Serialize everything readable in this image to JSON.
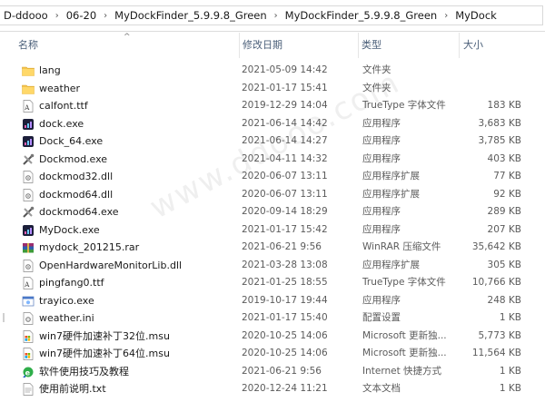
{
  "breadcrumb": [
    "D-ddooo",
    "06-20",
    "MyDockFinder_5.9.9.8_Green",
    "MyDockFinder_5.9.9.8_Green",
    "MyDock"
  ],
  "columns": {
    "name": "名称",
    "date": "修改日期",
    "type": "类型",
    "size": "大小"
  },
  "files": [
    {
      "name": "lang",
      "date": "2021-05-09 14:42",
      "type": "文件夹",
      "size": "",
      "icon": "folder-icon"
    },
    {
      "name": "weather",
      "date": "2021-01-17 15:41",
      "type": "文件夹",
      "size": "",
      "icon": "folder-icon"
    },
    {
      "name": "calfont.ttf",
      "date": "2019-12-29 14:04",
      "type": "TrueType 字体文件",
      "size": "183 KB",
      "icon": "font-file-icon"
    },
    {
      "name": "dock.exe",
      "date": "2021-06-14 14:42",
      "type": "应用程序",
      "size": "3,683 KB",
      "icon": "dock-app-icon"
    },
    {
      "name": "Dock_64.exe",
      "date": "2021-06-14 14:27",
      "type": "应用程序",
      "size": "3,785 KB",
      "icon": "dock-app-icon"
    },
    {
      "name": "Dockmod.exe",
      "date": "2021-04-11 14:32",
      "type": "应用程序",
      "size": "403 KB",
      "icon": "tools-icon"
    },
    {
      "name": "dockmod32.dll",
      "date": "2020-06-07 13:11",
      "type": "应用程序扩展",
      "size": "77 KB",
      "icon": "dll-file-icon"
    },
    {
      "name": "dockmod64.dll",
      "date": "2020-06-07 13:11",
      "type": "应用程序扩展",
      "size": "92 KB",
      "icon": "dll-file-icon"
    },
    {
      "name": "dockmod64.exe",
      "date": "2020-09-14 18:29",
      "type": "应用程序",
      "size": "289 KB",
      "icon": "tools-icon"
    },
    {
      "name": "MyDock.exe",
      "date": "2021-01-17 15:42",
      "type": "应用程序",
      "size": "207 KB",
      "icon": "dock-app-icon"
    },
    {
      "name": "mydock_201215.rar",
      "date": "2021-06-21 9:56",
      "type": "WinRAR 压缩文件",
      "size": "35,642 KB",
      "icon": "archive-icon"
    },
    {
      "name": "OpenHardwareMonitorLib.dll",
      "date": "2021-03-28 13:08",
      "type": "应用程序扩展",
      "size": "305 KB",
      "icon": "dll-file-icon"
    },
    {
      "name": "pingfang0.ttf",
      "date": "2021-01-25 18:55",
      "type": "TrueType 字体文件",
      "size": "10,766 KB",
      "icon": "font-file-icon"
    },
    {
      "name": "trayico.exe",
      "date": "2019-10-17 19:44",
      "type": "应用程序",
      "size": "248 KB",
      "icon": "app-window-icon"
    },
    {
      "name": "weather.ini",
      "date": "2021-01-17 15:40",
      "type": "配置设置",
      "size": "1 KB",
      "icon": "config-file-icon"
    },
    {
      "name": "win7硬件加速补丁32位.msu",
      "date": "2020-10-25 14:06",
      "type": "Microsoft 更新独...",
      "size": "5,773 KB",
      "icon": "update-package-icon"
    },
    {
      "name": "win7硬件加速补丁64位.msu",
      "date": "2020-10-25 14:06",
      "type": "Microsoft 更新独...",
      "size": "11,564 KB",
      "icon": "update-package-icon"
    },
    {
      "name": "软件使用技巧及教程",
      "date": "2021-06-21 9:56",
      "type": "Internet 快捷方式",
      "size": "1 KB",
      "icon": "internet-shortcut-icon"
    },
    {
      "name": "使用前说明.txt",
      "date": "2020-12-24 11:21",
      "type": "文本文档",
      "size": "1 KB",
      "icon": "text-file-icon"
    }
  ]
}
